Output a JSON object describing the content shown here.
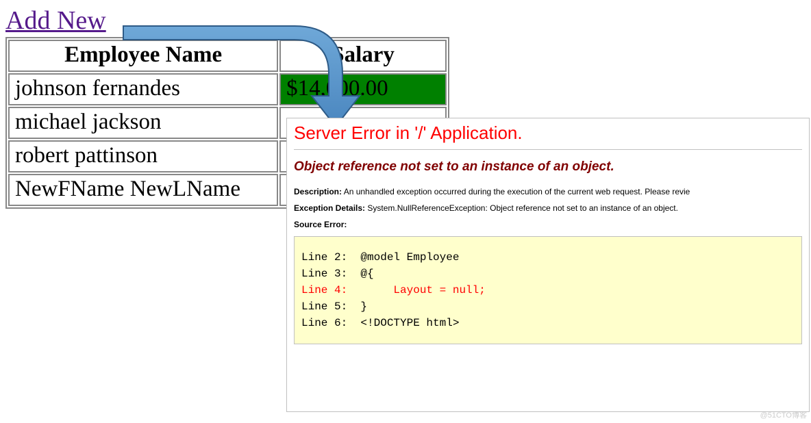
{
  "left": {
    "add_link": "Add New",
    "headers": {
      "name": "Employee Name",
      "salary": "Salary"
    },
    "rows": [
      {
        "name": "johnson fernandes",
        "salary": "$14,000.00",
        "green": true
      },
      {
        "name": "michael jackson",
        "salary": ""
      },
      {
        "name": "robert pattinson",
        "salary": ""
      },
      {
        "name": "NewFName NewLName",
        "salary": ""
      }
    ]
  },
  "error": {
    "title": "Server Error in '/' Application.",
    "subtitle": "Object reference not set to an instance of an object.",
    "description_label": "Description:",
    "description_text": "An unhandled exception occurred during the execution of the current web request. Please revie",
    "exception_label": "Exception Details:",
    "exception_text": "System.NullReferenceException: Object reference not set to an instance of an object.",
    "source_label": "Source Error:",
    "code": {
      "line2": "Line 2:  @model Employee",
      "line3": "Line 3:  @{",
      "line4": "Line 4:       Layout = null;",
      "line5": "Line 5:  }",
      "line6": "Line 6:  <!DOCTYPE html>"
    }
  },
  "watermark": "@51CTO博客"
}
